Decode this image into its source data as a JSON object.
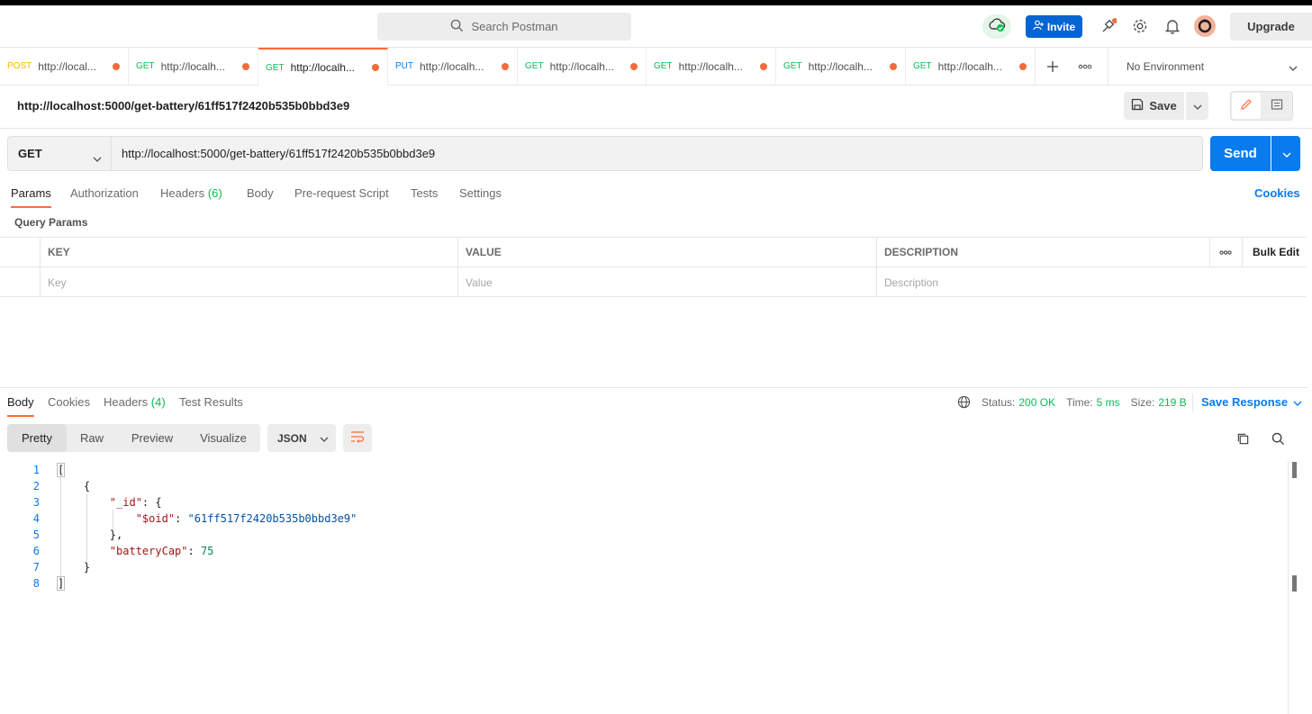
{
  "header": {
    "search_placeholder": "Search Postman",
    "invite_label": "Invite",
    "upgrade_label": "Upgrade"
  },
  "tabs": [
    {
      "method": "POST",
      "url": "http://local..."
    },
    {
      "method": "GET",
      "url": "http://localh..."
    },
    {
      "method": "GET",
      "url": "http://localh..."
    },
    {
      "method": "PUT",
      "url": "http://localh..."
    },
    {
      "method": "GET",
      "url": "http://localh..."
    },
    {
      "method": "GET",
      "url": "http://localh..."
    },
    {
      "method": "GET",
      "url": "http://localh..."
    },
    {
      "method": "GET",
      "url": "http://localh..."
    }
  ],
  "environment": {
    "selected": "No Environment"
  },
  "request": {
    "name": "http://localhost:5000/get-battery/61ff517f2420b535b0bbd3e9",
    "save_label": "Save",
    "method": "GET",
    "url": "http://localhost:5000/get-battery/61ff517f2420b535b0bbd3e9",
    "send_label": "Send",
    "tabs": {
      "params": "Params",
      "authorization": "Authorization",
      "headers": "Headers",
      "headers_count": "(6)",
      "body": "Body",
      "prerequest": "Pre-request Script",
      "tests": "Tests",
      "settings": "Settings"
    },
    "cookies_label": "Cookies"
  },
  "query_params": {
    "title": "Query Params",
    "columns": [
      "KEY",
      "VALUE",
      "DESCRIPTION"
    ],
    "bulk_edit": "Bulk Edit",
    "placeholders": [
      "Key",
      "Value",
      "Description"
    ]
  },
  "response": {
    "tabs": {
      "body": "Body",
      "cookies": "Cookies",
      "headers": "Headers",
      "headers_count": "(4)",
      "test_results": "Test Results"
    },
    "status_label": "Status:",
    "status_value": "200 OK",
    "time_label": "Time:",
    "time_value": "5 ms",
    "size_label": "Size:",
    "size_value": "219 B",
    "save_response": "Save Response",
    "views": [
      "Pretty",
      "Raw",
      "Preview",
      "Visualize"
    ],
    "format": "JSON",
    "body_lines": [
      {
        "n": "1"
      },
      {
        "n": "2"
      },
      {
        "n": "3"
      },
      {
        "n": "4"
      },
      {
        "n": "5"
      },
      {
        "n": "6"
      },
      {
        "n": "7"
      },
      {
        "n": "8"
      }
    ],
    "json": {
      "id_key": "\"_id\"",
      "oid_key": "\"$oid\"",
      "oid_value": "\"61ff517f2420b535b0bbd3e9\"",
      "cap_key": "\"batteryCap\"",
      "cap_value": "75"
    }
  }
}
